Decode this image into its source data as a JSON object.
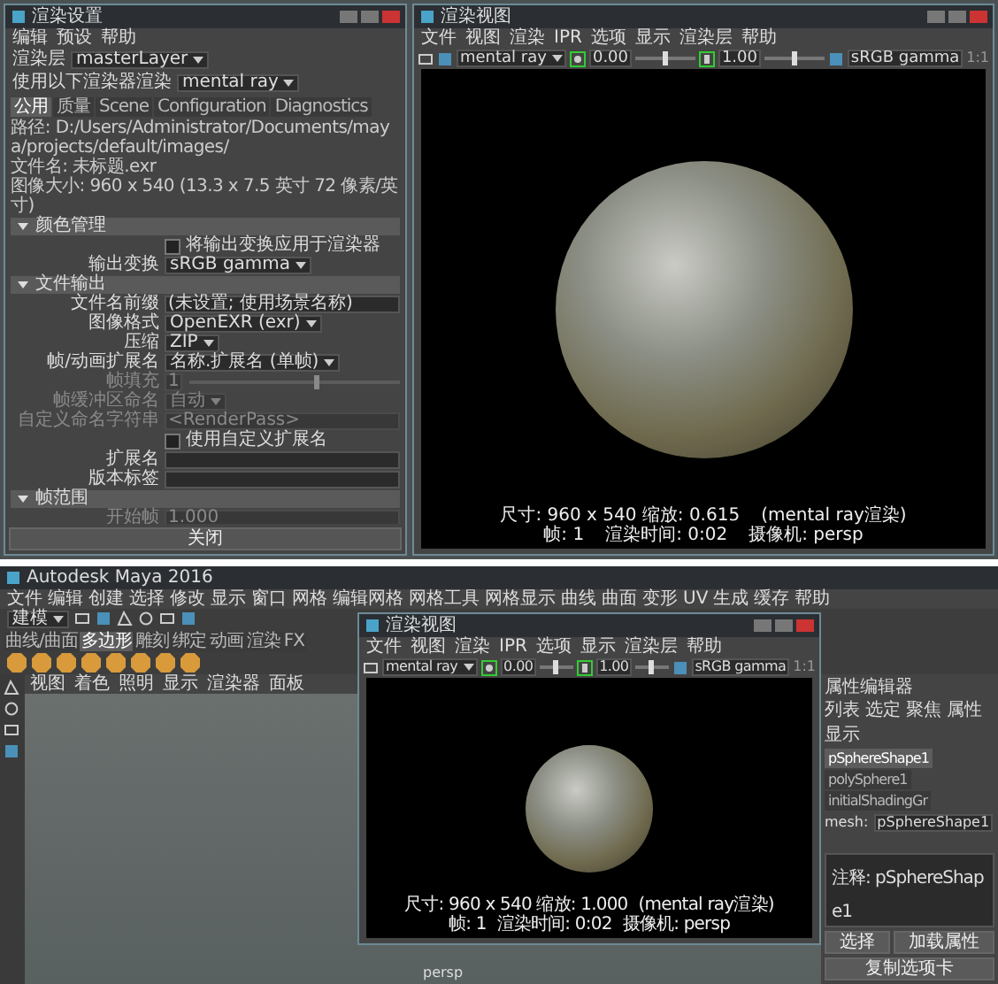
{
  "top_screenshot": {
    "render_settings": {
      "title": "渲染设置",
      "menu": [
        "编辑",
        "预设",
        "帮助"
      ],
      "render_layer": {
        "label": "渲染层",
        "value": "masterLayer"
      },
      "renderer": {
        "label": "使用以下渲染器渲染",
        "value": "mental ray"
      },
      "tabs": [
        {
          "label": "公用",
          "selected": true
        },
        {
          "label": "质量",
          "selected": false
        },
        {
          "label": "Scene",
          "selected": false
        },
        {
          "label": "Configuration",
          "selected": false
        },
        {
          "label": "Diagnostics",
          "selected": false
        }
      ],
      "info_lines": [
        "路径: D:/Users/Administrator/Documents/maya/projects/default/images/",
        "文件名: 未标题.exr",
        "图像大小: 960 x 540 (13.3 x 7.5 英寸 72 像素/英寸)"
      ],
      "sections": [
        {
          "title": "颜色管理",
          "expanded": true,
          "rows": [
            {
              "kind": "checkbox",
              "label": "将输出变换应用于渲染器",
              "checked": false,
              "disabled": false
            },
            {
              "kind": "dropdown",
              "label": "输出变换",
              "value": "sRGB gamma",
              "disabled": false
            }
          ]
        },
        {
          "title": "文件输出",
          "expanded": true,
          "rows": [
            {
              "kind": "field",
              "label": "文件名前缀",
              "value": "(未设置; 使用场景名称)",
              "disabled": false
            },
            {
              "kind": "dropdown",
              "label": "图像格式",
              "value": "OpenEXR (exr)",
              "disabled": false
            },
            {
              "kind": "dropdown",
              "label": "压缩",
              "value": "ZIP",
              "disabled": false
            },
            {
              "kind": "dropdown",
              "label": "帧/动画扩展名",
              "value": "名称.扩展名 (单帧)",
              "disabled": false
            },
            {
              "kind": "slider",
              "label": "帧填充",
              "value": "1",
              "level": 0.6,
              "disabled": true
            },
            {
              "kind": "dropdown",
              "label": "帧缓冲区命名",
              "value": "自动",
              "disabled": true
            },
            {
              "kind": "field",
              "label": "自定义命名字符串",
              "value": "<RenderPass>",
              "disabled": true
            },
            {
              "kind": "checkbox",
              "label": "使用自定义扩展名",
              "checked": false,
              "disabled": false
            },
            {
              "kind": "field",
              "label": "扩展名",
              "disabled": false
            },
            {
              "kind": "field",
              "label": "版本标签",
              "disabled": false
            }
          ]
        },
        {
          "title": "帧范围",
          "expanded": true,
          "rows": [
            {
              "kind": "field",
              "label": "开始帧",
              "value": "1.000",
              "disabled": true
            }
          ]
        }
      ],
      "close_button": "关闭"
    },
    "render_view": {
      "title": "渲染视图",
      "menu": [
        "文件",
        "视图",
        "渲染",
        "IPR",
        "选项",
        "显示",
        "渲染层",
        "帮助"
      ],
      "renderer": "mental ray",
      "exposure": {
        "value": "0.00",
        "level": 0.5
      },
      "gamma": {
        "value": "1.00",
        "level": 0.5
      },
      "view_transform": "sRGB gamma",
      "zoom_label": "1:1",
      "status": [
        [
          "尺寸: 960 x 540 缩放: 0.615",
          "(mental ray渲染)"
        ],
        [
          "帧: 1",
          "渲染时间: 0:02",
          "摄像机: persp"
        ]
      ]
    }
  },
  "bottom_screenshot": {
    "main_window": {
      "title": "Autodesk Maya 2016",
      "menu": [
        "文件",
        "编辑",
        "创建",
        "选择",
        "修改",
        "显示",
        "窗口",
        "网格",
        "编辑网格",
        "网格工具",
        "网格显示",
        "曲线",
        "曲面",
        "变形",
        "UV",
        "生成",
        "缓存",
        "帮助"
      ],
      "mode": "建模",
      "shelf_tabs": [
        {
          "label": "曲线/曲面",
          "selected": false
        },
        {
          "label": "多边形",
          "selected": true
        },
        {
          "label": "雕刻",
          "selected": false
        },
        {
          "label": "绑定",
          "selected": false
        },
        {
          "label": "动画",
          "selected": false
        },
        {
          "label": "渲染",
          "selected": false
        },
        {
          "label": "FX",
          "selected": false
        }
      ],
      "viewport_menu": [
        "视图",
        "着色",
        "照明",
        "显示",
        "渲染器",
        "面板"
      ],
      "camera_label": "persp"
    },
    "render_view": {
      "title": "渲染视图",
      "menu": [
        "文件",
        "视图",
        "渲染",
        "IPR",
        "选项",
        "显示",
        "渲染层",
        "帮助"
      ],
      "renderer": "mental ray",
      "exposure": {
        "value": "0.00",
        "level": 0.5
      },
      "gamma": {
        "value": "1.00",
        "level": 0.5
      },
      "view_transform": "sRGB gamma",
      "zoom_label": "1:1",
      "status": [
        [
          "尺寸: 960 x 540 缩放: 1.000",
          "(mental ray渲染)"
        ],
        [
          "帧: 1",
          "渲染时间: 0:02",
          "摄像机: persp"
        ]
      ]
    },
    "attribute_editor": {
      "title": "属性编辑器",
      "menu": [
        "列表",
        "选定",
        "聚焦",
        "属性",
        "显示"
      ],
      "tabs": [
        {
          "label": "pSphereShape1",
          "selected": true
        },
        {
          "label": "polySphere1",
          "selected": false
        },
        {
          "label": "initialShadingGr",
          "selected": false
        }
      ],
      "node_label": "mesh:",
      "node_value": "pSphereShape1",
      "notes_label": "注释: pSphereShape1",
      "buttons": [
        "选择",
        "加载属性",
        "复制选项卡"
      ]
    }
  }
}
